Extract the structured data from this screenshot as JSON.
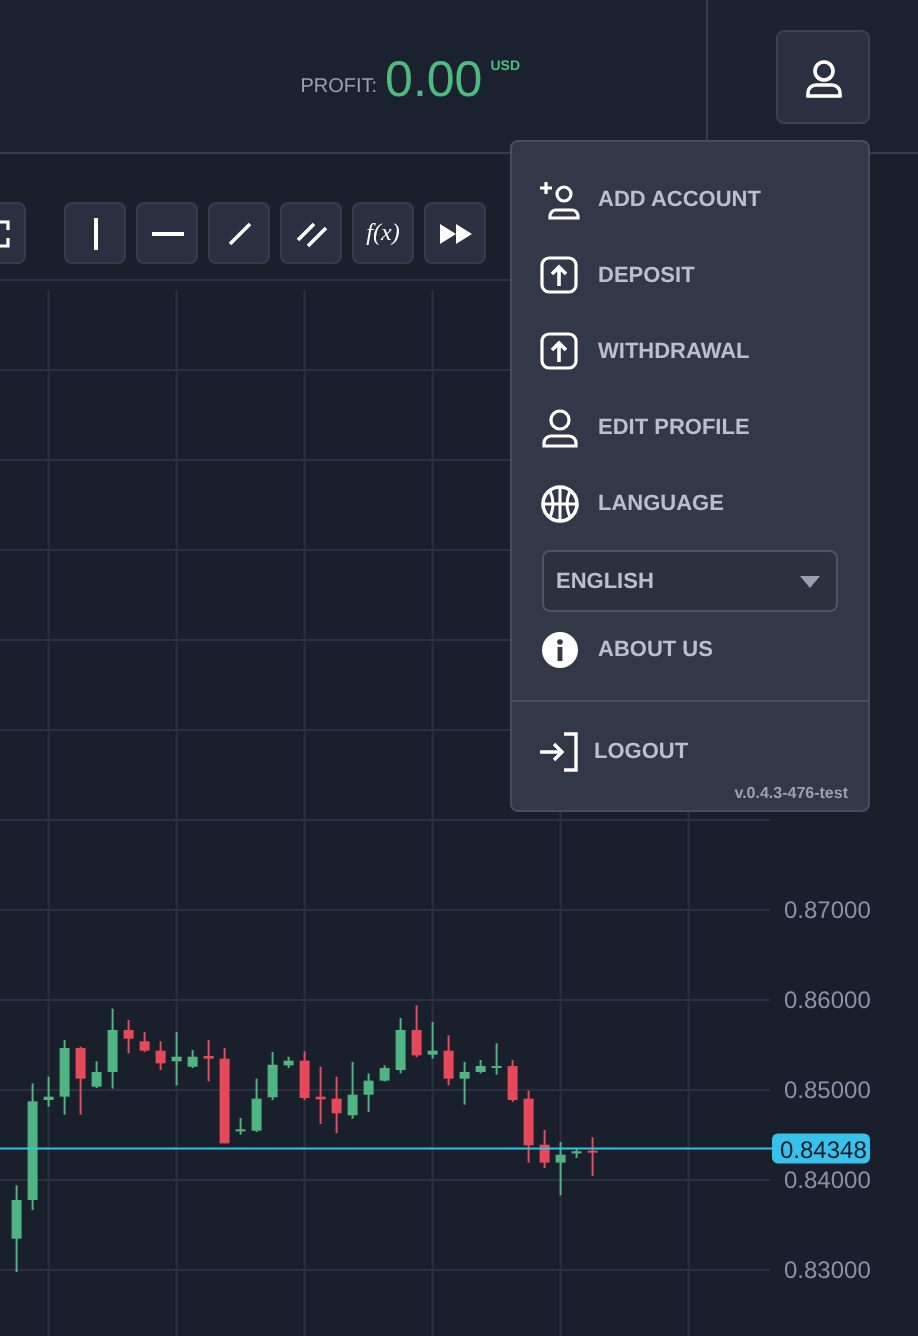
{
  "header": {
    "profit_label": "PROFIT:",
    "profit_value": "0.00",
    "profit_currency": "USD"
  },
  "toolbar": {
    "tools": [
      {
        "kind": "expand"
      },
      {
        "kind": "vertical-line"
      },
      {
        "kind": "horizontal-line"
      },
      {
        "kind": "trend-line"
      },
      {
        "kind": "parallel-lines"
      },
      {
        "kind": "function",
        "label": "f(x)"
      },
      {
        "kind": "fast-forward"
      }
    ]
  },
  "chart": {
    "price_axis": [
      "0.87000",
      "0.86000",
      "0.85000",
      "0.84000",
      "0.83000"
    ],
    "current_price": "0.84348"
  },
  "user_menu": {
    "items": [
      {
        "kind": "add-account",
        "label": "ADD ACCOUNT"
      },
      {
        "kind": "deposit",
        "label": "DEPOSIT"
      },
      {
        "kind": "withdrawal",
        "label": "WITHDRAWAL"
      },
      {
        "kind": "profile",
        "label": "EDIT PROFILE"
      },
      {
        "kind": "language",
        "label": "LANGUAGE"
      },
      {
        "kind": "select",
        "value": "ENGLISH"
      },
      {
        "kind": "about",
        "label": "ABOUT US"
      }
    ],
    "logout": {
      "label": "LOGOUT"
    },
    "version": "v.0.4.3-476-test"
  }
}
